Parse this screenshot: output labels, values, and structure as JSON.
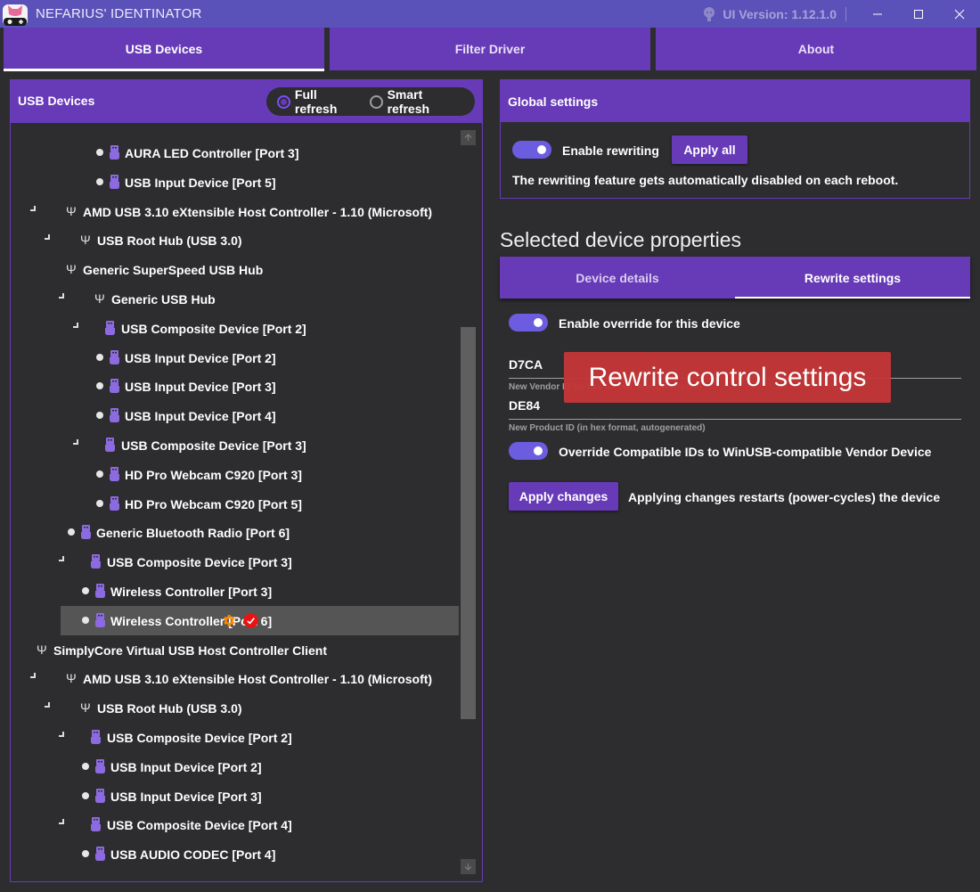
{
  "window": {
    "title": "NEFARIUS' IDENTINATOR",
    "ui_version": "UI Version: 1.12.1.0",
    "minimize_label": "minimize",
    "maximize_label": "maximize",
    "close_label": "close"
  },
  "top_tabs": [
    {
      "label": "USB Devices",
      "active": true
    },
    {
      "label": "Filter Driver",
      "active": false
    },
    {
      "label": "About",
      "active": false
    }
  ],
  "left_panel": {
    "title": "USB Devices",
    "refresh_options": [
      {
        "label": "Full refresh",
        "checked": true
      },
      {
        "label": "Smart refresh",
        "checked": false
      }
    ],
    "tree": [
      {
        "label": "AURA LED Controller [Port 3]",
        "type": "device",
        "level": 3
      },
      {
        "label": "USB Input Device [Port 5]",
        "type": "device",
        "level": 3
      },
      {
        "label": "AMD USB 3.10 eXtensible Host Controller - 1.10 (Microsoft)",
        "type": "hub",
        "level": 1,
        "expanded": true
      },
      {
        "label": "USB Root Hub (USB 3.0)",
        "type": "hub",
        "level": 2,
        "expanded": true
      },
      {
        "label": "Generic SuperSpeed USB Hub",
        "type": "hub",
        "level": 2,
        "expanded": false
      },
      {
        "label": "Generic USB Hub",
        "type": "hub",
        "level": 3,
        "expanded": true
      },
      {
        "label": "USB Composite Device [Port 2]",
        "type": "composite",
        "level": 4,
        "expanded": true
      },
      {
        "label": "USB Input Device [Port 2]",
        "type": "device",
        "level": 5
      },
      {
        "label": "USB Input Device [Port 3]",
        "type": "device",
        "level": 5
      },
      {
        "label": "USB Input Device [Port 4]",
        "type": "device",
        "level": 5
      },
      {
        "label": "USB Composite Device [Port 3]",
        "type": "composite",
        "level": 4,
        "expanded": true
      },
      {
        "label": "HD Pro Webcam C920 [Port 3]",
        "type": "device",
        "level": 5
      },
      {
        "label": "HD Pro Webcam C920 [Port 5]",
        "type": "device",
        "level": 5
      },
      {
        "label": "Generic Bluetooth Radio [Port 6]",
        "type": "device",
        "level": 3
      },
      {
        "label": "USB Composite Device [Port 3]",
        "type": "composite",
        "level": 3,
        "expanded": true
      },
      {
        "label": "Wireless Controller [Port 3]",
        "type": "device",
        "level": 4
      },
      {
        "label": "Wireless Controller [Port 6]",
        "type": "device",
        "level": 4,
        "selected": true,
        "badges": [
          "gear-icon",
          "check-icon"
        ]
      },
      {
        "label": "SimplyCore Virtual USB Host Controller Client",
        "type": "hub",
        "level": 0
      },
      {
        "label": "AMD USB 3.10 eXtensible Host Controller - 1.10 (Microsoft)",
        "type": "hub",
        "level": 1,
        "expanded": true
      },
      {
        "label": "USB Root Hub (USB 3.0)",
        "type": "hub",
        "level": 2,
        "expanded": true
      },
      {
        "label": "USB Composite Device [Port 2]",
        "type": "composite",
        "level": 3,
        "expanded": true
      },
      {
        "label": "USB Input Device [Port 2]",
        "type": "device",
        "level": 4
      },
      {
        "label": "USB Input Device [Port 3]",
        "type": "device",
        "level": 4
      },
      {
        "label": "USB Composite Device [Port 4]",
        "type": "composite",
        "level": 3,
        "expanded": true
      },
      {
        "label": "USB AUDIO  CODEC [Port 4]",
        "type": "device",
        "level": 4
      }
    ],
    "scroll_position": 0.45
  },
  "global_settings": {
    "title": "Global settings",
    "enable_rewriting_label": "Enable rewriting",
    "enable_rewriting_on": true,
    "apply_all_label": "Apply all",
    "note": "The rewriting feature gets automatically disabled on each reboot."
  },
  "device_properties": {
    "title": "Selected device properties",
    "tabs": [
      {
        "label": "Device details",
        "active": false
      },
      {
        "label": "Rewrite settings",
        "active": true
      }
    ],
    "enable_override_label": "Enable override for this device",
    "enable_override_on": true,
    "vendor_id": {
      "value": "D7CA",
      "hint": "New Vendor ID (in hex format, autogenerated)"
    },
    "product_id": {
      "value": "DE84",
      "hint": "New Product ID (in hex format, autogenerated)"
    },
    "override_compat_label": "Override Compatible IDs to WinUSB-compatible Vendor Device",
    "override_compat_on": true,
    "apply_changes_label": "Apply changes",
    "apply_changes_note": "Applying changes restarts (power-cycles) the device"
  },
  "overlay_annotation": "Rewrite control settings",
  "colors": {
    "accent": "#673ab7",
    "titlebar": "#5a52b8",
    "toggle": "#6c5ce0",
    "background": "#2d2d30",
    "selected_row": "#555555",
    "gear": "#ff8c00",
    "check_badge": "#ee1111",
    "overlay": "#c43636"
  }
}
